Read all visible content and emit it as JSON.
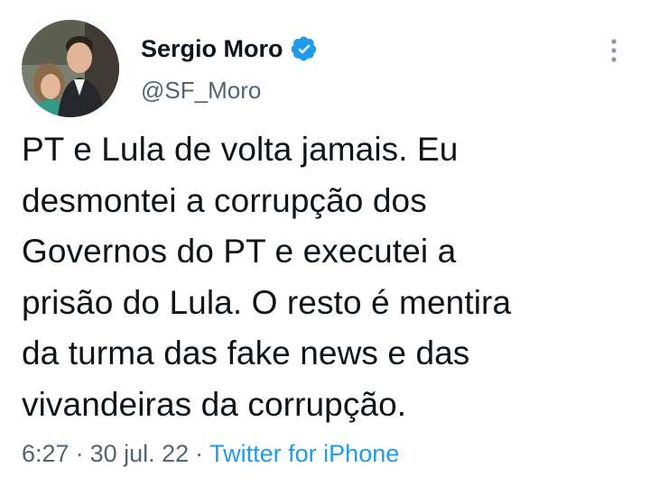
{
  "tweet": {
    "author_name": "Sergio Moro",
    "author_handle": "@SF_Moro",
    "text": "PT e Lula de volta jamais. Eu\ndesmontei a corrupção dos\nGovernos do PT e executei a\nprisão do Lula. O resto é mentira\nda turma das fake news e das\nvivandeiras da corrupção.",
    "time": "6:27",
    "date": "30 jul. 22",
    "separator": "·",
    "source": "Twitter for iPhone"
  },
  "icons": {
    "verified": "verified-badge-icon",
    "more": "more-options-icon"
  },
  "colors": {
    "verified": "#1d9bf0",
    "link": "#1d9bf0",
    "secondary_text": "#536471",
    "primary_text": "#0f1419"
  }
}
